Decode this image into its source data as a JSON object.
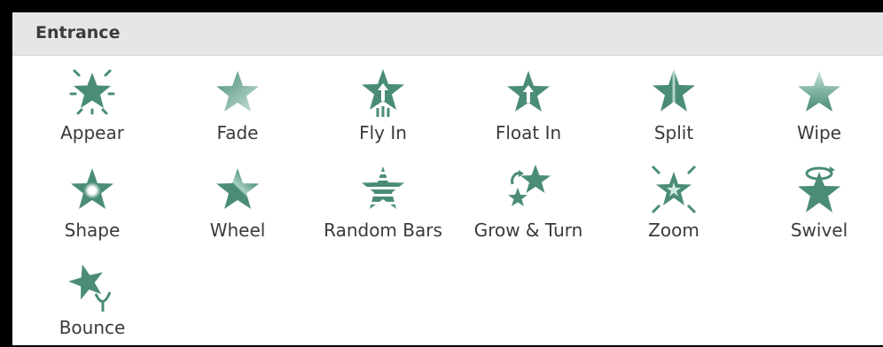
{
  "panel": {
    "header": "Entrance",
    "accent_color": "#4a8c78",
    "light_color": "#b9dbd0",
    "effects": [
      {
        "label": "Appear",
        "icon": "appear-star-icon"
      },
      {
        "label": "Fade",
        "icon": "fade-star-icon"
      },
      {
        "label": "Fly In",
        "icon": "fly-in-star-icon"
      },
      {
        "label": "Float In",
        "icon": "float-in-star-icon"
      },
      {
        "label": "Split",
        "icon": "split-star-icon"
      },
      {
        "label": "Wipe",
        "icon": "wipe-star-icon"
      },
      {
        "label": "Shape",
        "icon": "shape-star-icon"
      },
      {
        "label": "Wheel",
        "icon": "wheel-star-icon"
      },
      {
        "label": "Random Bars",
        "icon": "random-bars-star-icon"
      },
      {
        "label": "Grow & Turn",
        "icon": "grow-turn-star-icon"
      },
      {
        "label": "Zoom",
        "icon": "zoom-star-icon"
      },
      {
        "label": "Swivel",
        "icon": "swivel-star-icon"
      },
      {
        "label": "Bounce",
        "icon": "bounce-star-icon"
      }
    ]
  }
}
